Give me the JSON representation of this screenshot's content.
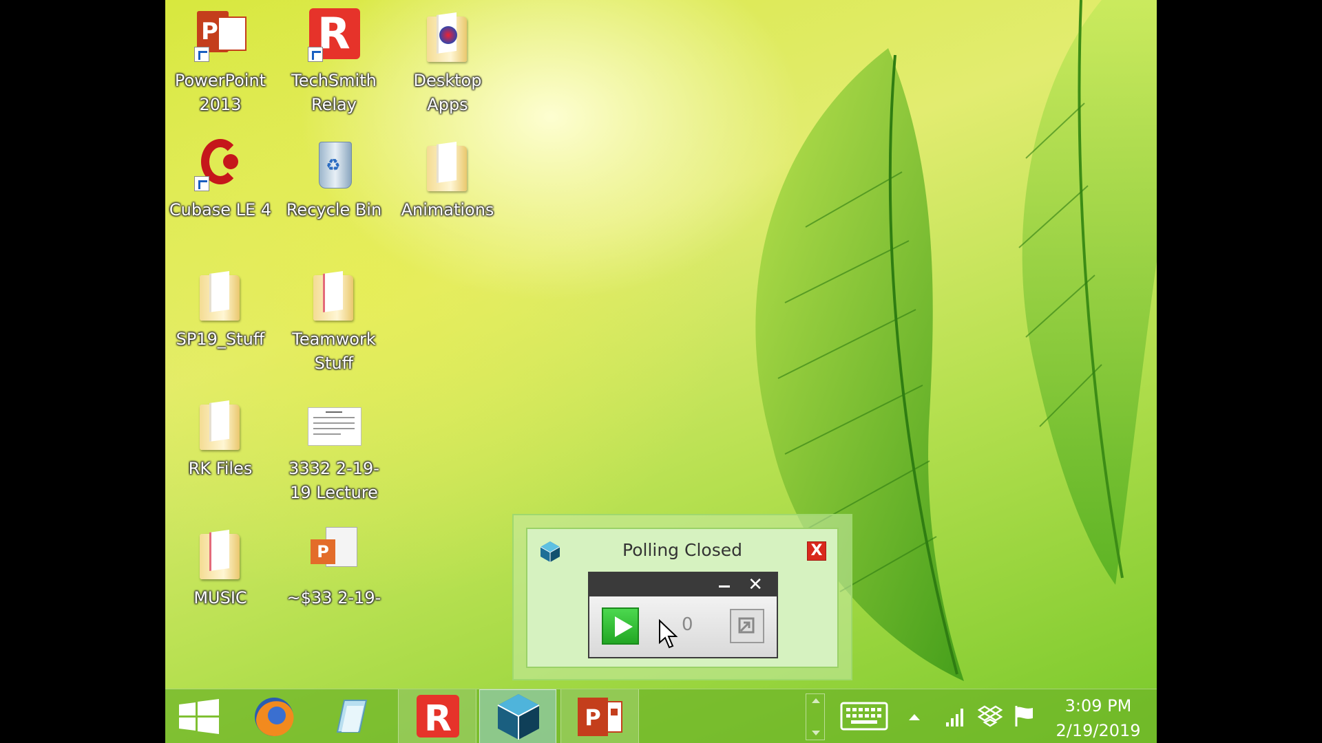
{
  "desktop": {
    "icons": [
      {
        "label": "PowerPoint 2013",
        "icon": "powerpoint-icon"
      },
      {
        "label": "TechSmith Relay",
        "icon": "techsmith-relay-icon"
      },
      {
        "label": "Desktop Apps",
        "icon": "desktop-apps-icon"
      },
      {
        "label": "Cubase LE 4",
        "icon": "cubase-icon"
      },
      {
        "label": "Recycle Bin",
        "icon": "recycle-bin-icon"
      },
      {
        "label": "Animations",
        "icon": "folder-icon"
      },
      {
        "label": "SP19_Stuff",
        "icon": "folder-icon"
      },
      {
        "label": "Teamwork Stuff",
        "icon": "folder-icon"
      },
      {
        "label": "RK Files",
        "icon": "folder-icon"
      },
      {
        "label": "3332 2-19-19 Lecture",
        "icon": "document-icon"
      },
      {
        "label": "MUSIC",
        "icon": "folder-icon"
      },
      {
        "label": "~$33 2-19-",
        "icon": "powerpoint-file-icon"
      }
    ]
  },
  "popup": {
    "title": "Polling Closed",
    "close_label": "X",
    "response_count": "0",
    "minimize_label": "_",
    "mini_close_label": "✕"
  },
  "taskbar": {
    "items": [
      "start-icon",
      "firefox-icon",
      "file-explorer-icon",
      "techsmith-relay-icon",
      "polling-app-icon",
      "powerpoint-icon"
    ],
    "time": "3:09 PM",
    "date": "2/19/2019"
  },
  "colors": {
    "accent_green": "#22a724",
    "close_red": "#d9291c",
    "powerpoint_red": "#c43e1c"
  }
}
